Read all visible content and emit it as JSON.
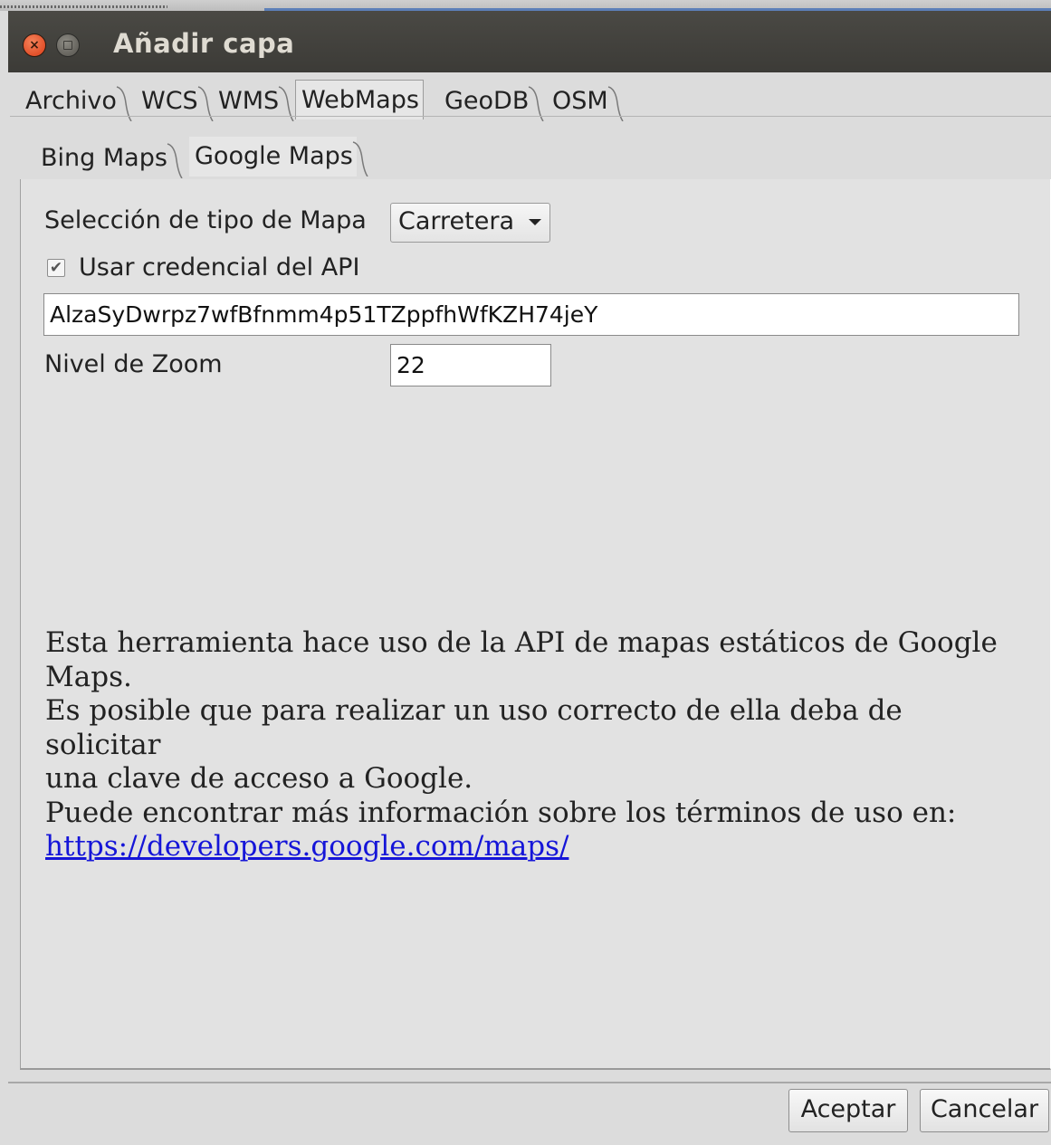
{
  "window": {
    "title": "Añadir capa"
  },
  "outer_tabs": [
    {
      "label": "Archivo",
      "selected": false
    },
    {
      "label": "WCS",
      "selected": false
    },
    {
      "label": "WMS",
      "selected": false
    },
    {
      "label": "WebMaps",
      "selected": true
    },
    {
      "label": "GeoDB",
      "selected": false
    },
    {
      "label": "OSM",
      "selected": false
    }
  ],
  "inner_tabs": [
    {
      "label": "Bing Maps",
      "selected": false
    },
    {
      "label": "Google Maps",
      "selected": true
    }
  ],
  "form": {
    "map_type_label": "Selección de tipo de Mapa",
    "map_type_value": "Carretera",
    "use_api_label": "Usar credencial del API",
    "use_api_checked": true,
    "api_key_value": "AlzaSyDwrpz7wfBfnmm4p51TZppfhWfKZH74jeY",
    "zoom_label": "Nivel de Zoom",
    "zoom_value": "22"
  },
  "info": {
    "line1": "Esta herramienta hace uso de la API de mapas estáticos de Google",
    "line2": "Maps.",
    "line3": "Es posible que para realizar un uso correcto de ella deba de solicitar",
    "line4": "una clave de acceso a Google.",
    "line5": "Puede encontrar más información sobre los términos de uso en:",
    "link": "https://developers.google.com/maps/"
  },
  "buttons": {
    "accept": "Aceptar",
    "cancel": "Cancelar"
  }
}
